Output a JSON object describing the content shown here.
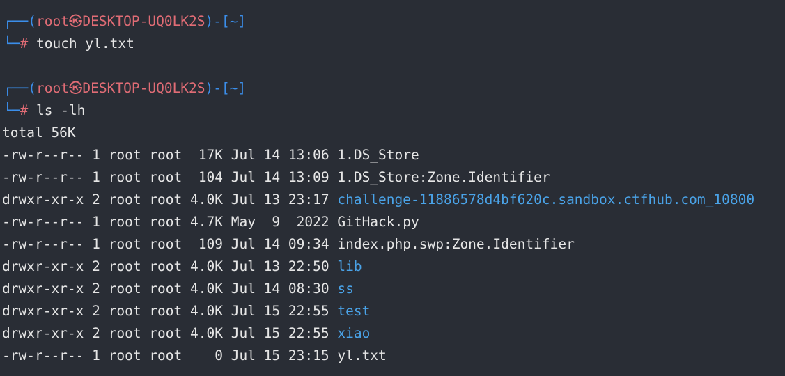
{
  "terminal": {
    "prompt": {
      "corner_top": "┌──(",
      "user": "root㉿DESKTOP-UQ0LK2S",
      "mid": ")-[",
      "cwd": "~",
      "end": "]",
      "corner_bottom": "└─",
      "hash": "#"
    },
    "commands": [
      {
        "text": " touch yl.txt"
      },
      {
        "text": " ls -lh"
      }
    ],
    "total": "total 56K",
    "listing": [
      {
        "meta": "-rw-r--r-- 1 root root  17K Jul 14 13:06 ",
        "name": "1.DS_Store",
        "type": "file"
      },
      {
        "meta": "-rw-r--r-- 1 root root  104 Jul 14 13:09 ",
        "name": "1.DS_Store:Zone.Identifier",
        "type": "file"
      },
      {
        "meta": "drwxr-xr-x 2 root root 4.0K Jul 13 23:17 ",
        "name": "challenge-11886578d4bf620c.sandbox.ctfhub.com_10800",
        "type": "dir"
      },
      {
        "meta": "-rw-r--r-- 1 root root 4.7K May  9  2022 ",
        "name": "GitHack.py",
        "type": "file"
      },
      {
        "meta": "-rw-r--r-- 1 root root  109 Jul 14 09:34 ",
        "name": "index.php.swp:Zone.Identifier",
        "type": "file"
      },
      {
        "meta": "drwxr-xr-x 2 root root 4.0K Jul 13 22:50 ",
        "name": "lib",
        "type": "dir"
      },
      {
        "meta": "drwxr-xr-x 2 root root 4.0K Jul 14 08:30 ",
        "name": "ss",
        "type": "dir"
      },
      {
        "meta": "drwxr-xr-x 2 root root 4.0K Jul 15 22:55 ",
        "name": "test",
        "type": "dir"
      },
      {
        "meta": "drwxr-xr-x 2 root root 4.0K Jul 15 22:55 ",
        "name": "xiao",
        "type": "dir"
      },
      {
        "meta": "-rw-r--r-- 1 root root    0 Jul 15 23:15 ",
        "name": "yl.txt",
        "type": "file"
      }
    ],
    "colors": {
      "background": "#292d35",
      "prompt_box": "#3b8eea",
      "prompt_user": "#e06c75",
      "directory": "#4aa3e8",
      "text": "#e6e6e6"
    }
  }
}
